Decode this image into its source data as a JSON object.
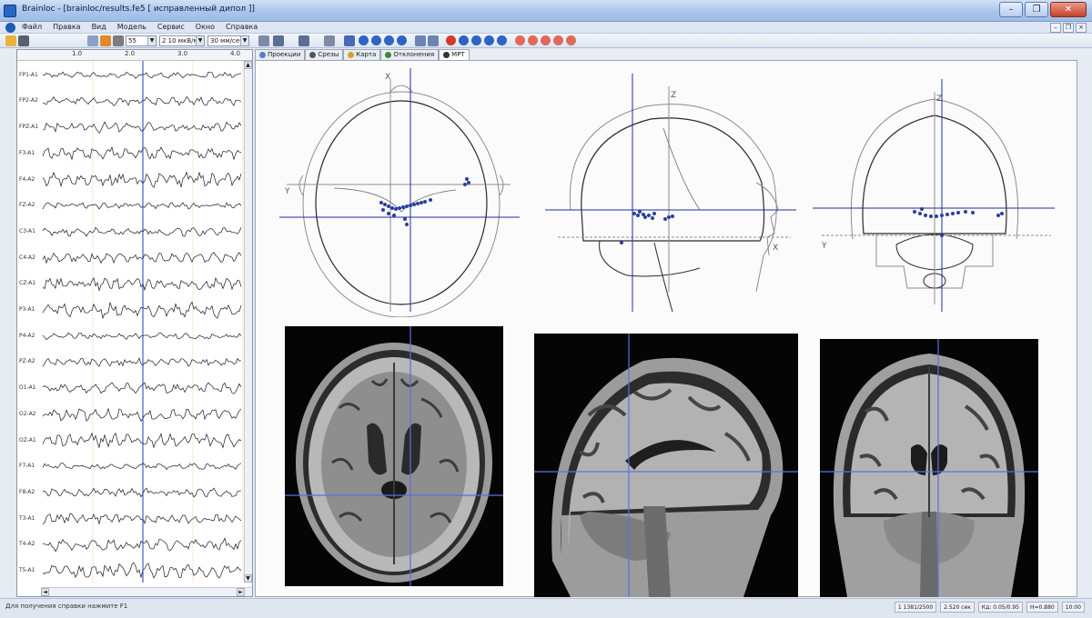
{
  "window": {
    "title": "Brainloc - [brainloc/results.fe5 [ исправленный дипол ]]",
    "buttons": [
      "–",
      "❐",
      "✕"
    ]
  },
  "menu": {
    "items": [
      "Файл",
      "Правка",
      "Вид",
      "Модель",
      "Сервис",
      "Окно",
      "Справка"
    ],
    "mdi_buttons": [
      "–",
      "❐",
      "×"
    ]
  },
  "toolbar": {
    "amplitude_combo": "55",
    "scale_combo": "2 10 мкВ/мм",
    "speed_combo": "30 мм/сек",
    "colors": {
      "circle_blue": "#2f63c4",
      "circle_red": "#d63a2a",
      "toolbar_icon": "#6b84b3"
    }
  },
  "eeg": {
    "ruler_ticks": [
      "1.0",
      "2.0",
      "3.0",
      "4.0"
    ],
    "channels": [
      "FP1-A1",
      "FP2-A2",
      "FPZ-A1",
      "F3-A1",
      "F4-A2",
      "FZ-A2",
      "C3-A1",
      "C4-A2",
      "CZ-A1",
      "P3-A1",
      "P4-A2",
      "PZ-A2",
      "O1-A1",
      "O2-A2",
      "OZ-A1",
      "F7-A1",
      "F8-A2",
      "T3-A1",
      "T4-A2",
      "T5-A1"
    ],
    "trace_color": "#1a1a1a",
    "cursor_color": "#1c3ad0"
  },
  "view_tabs": [
    "Проекции",
    "Срезы",
    "Карта",
    "Отклонения",
    "МРТ"
  ],
  "active_tab": "МРТ",
  "projections": {
    "axis_labels": {
      "axial": {
        "vertical": "X",
        "horizontal": "Y"
      },
      "sagittal": {
        "vertical": "Z",
        "horizontal": "X"
      },
      "coronal": {
        "vertical": "Z",
        "horizontal": "Y"
      }
    },
    "dipole_color": "#2b3fa0",
    "outline_color": "#6a6a6a"
  },
  "mri": {
    "crosshair_color": "#5a6fe8",
    "panes": [
      "axial",
      "sagittal",
      "coronal"
    ]
  },
  "status": {
    "left_text": "Для получения справки нажмите F1",
    "fields": [
      "1  1381/2500",
      "2.520 сек",
      "Кд: 0.05/0.95",
      "Н=0.880",
      "10:00"
    ]
  }
}
